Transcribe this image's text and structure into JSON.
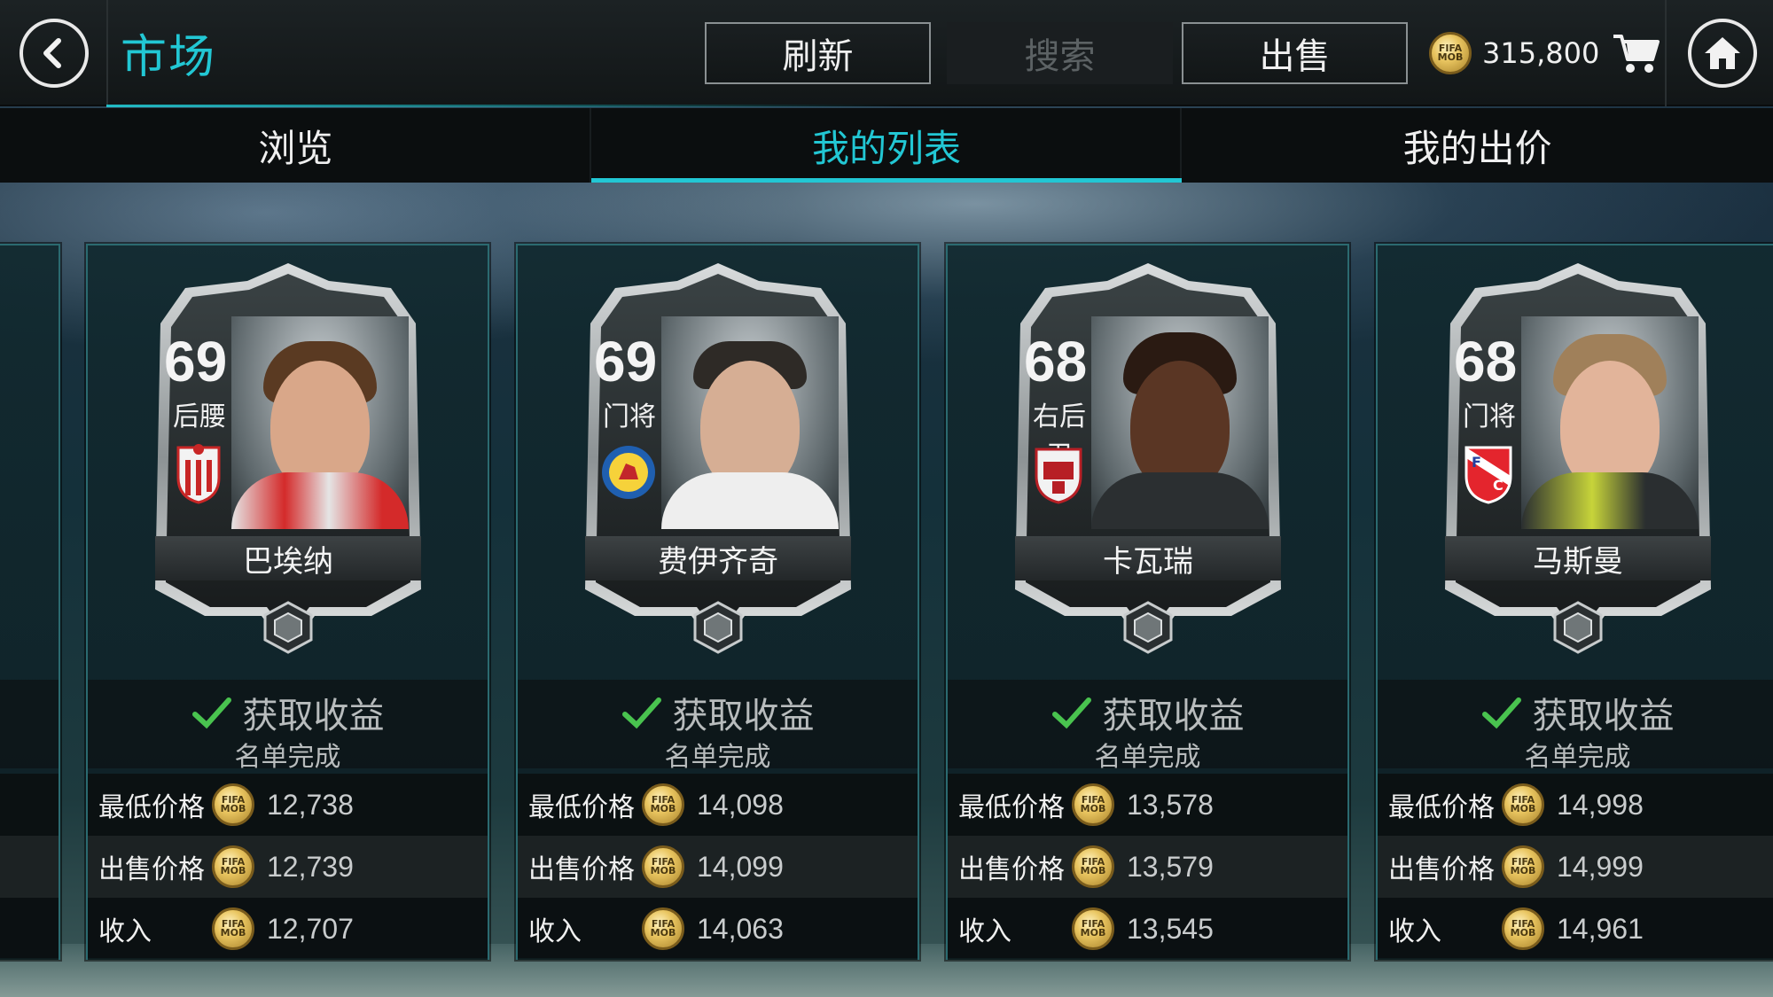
{
  "header": {
    "title": "市场",
    "refresh_label": "刷新",
    "search_label": "搜索",
    "sell_label": "出售",
    "coins": "315,800",
    "coin_text": "FIFA MOBILE"
  },
  "tabs": [
    {
      "label": "浏览",
      "active": false
    },
    {
      "label": "我的列表",
      "active": true
    },
    {
      "label": "我的出价",
      "active": false
    }
  ],
  "colors": {
    "accent": "#22c7d4",
    "check": "#49c34f",
    "coin_gold": "#e9c560"
  },
  "labels": {
    "min_price": "最低价格",
    "sell_price": "出售价格",
    "income": "收入"
  },
  "cards": [
    {
      "rating": "69",
      "position": "后腰",
      "name": "巴埃纳",
      "club_icon": "granada-badge-icon",
      "status": "获取收益",
      "sub_status": "名单完成",
      "min_price": "12,738",
      "sell_price": "12,739",
      "income": "12,707"
    },
    {
      "rating": "69",
      "position": "门将",
      "name": "费伊齐奇",
      "club_icon": "braunschweig-badge-icon",
      "status": "获取收益",
      "sub_status": "名单完成",
      "min_price": "14,098",
      "sell_price": "14,099",
      "income": "14,063"
    },
    {
      "rating": "68",
      "position": "右后卫",
      "name": "卡瓦瑞",
      "club_icon": "barnsley-badge-icon",
      "status": "获取收益",
      "sub_status": "名单完成",
      "min_price": "13,578",
      "sell_price": "13,579",
      "income": "13,545"
    },
    {
      "rating": "68",
      "position": "门将",
      "name": "马斯曼",
      "club_icon": "utrecht-badge-icon",
      "status": "获取收益",
      "sub_status": "名单完成",
      "min_price": "14,998",
      "sell_price": "14,999",
      "income": "14,961"
    }
  ]
}
